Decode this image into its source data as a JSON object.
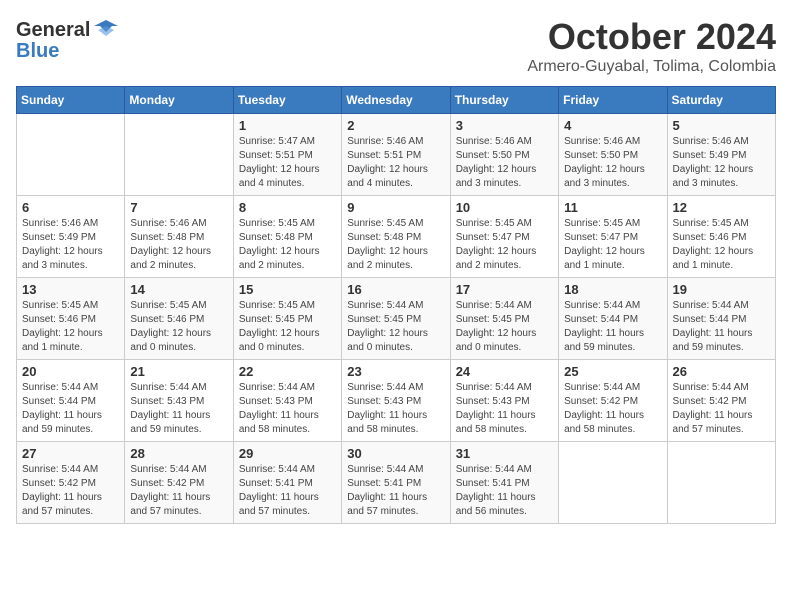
{
  "logo": {
    "line1": "General",
    "line2": "Blue"
  },
  "title": "October 2024",
  "subtitle": "Armero-Guyabal, Tolima, Colombia",
  "headers": [
    "Sunday",
    "Monday",
    "Tuesday",
    "Wednesday",
    "Thursday",
    "Friday",
    "Saturday"
  ],
  "weeks": [
    [
      {
        "day": "",
        "info": ""
      },
      {
        "day": "",
        "info": ""
      },
      {
        "day": "1",
        "info": "Sunrise: 5:47 AM\nSunset: 5:51 PM\nDaylight: 12 hours\nand 4 minutes."
      },
      {
        "day": "2",
        "info": "Sunrise: 5:46 AM\nSunset: 5:51 PM\nDaylight: 12 hours\nand 4 minutes."
      },
      {
        "day": "3",
        "info": "Sunrise: 5:46 AM\nSunset: 5:50 PM\nDaylight: 12 hours\nand 3 minutes."
      },
      {
        "day": "4",
        "info": "Sunrise: 5:46 AM\nSunset: 5:50 PM\nDaylight: 12 hours\nand 3 minutes."
      },
      {
        "day": "5",
        "info": "Sunrise: 5:46 AM\nSunset: 5:49 PM\nDaylight: 12 hours\nand 3 minutes."
      }
    ],
    [
      {
        "day": "6",
        "info": "Sunrise: 5:46 AM\nSunset: 5:49 PM\nDaylight: 12 hours\nand 3 minutes."
      },
      {
        "day": "7",
        "info": "Sunrise: 5:46 AM\nSunset: 5:48 PM\nDaylight: 12 hours\nand 2 minutes."
      },
      {
        "day": "8",
        "info": "Sunrise: 5:45 AM\nSunset: 5:48 PM\nDaylight: 12 hours\nand 2 minutes."
      },
      {
        "day": "9",
        "info": "Sunrise: 5:45 AM\nSunset: 5:48 PM\nDaylight: 12 hours\nand 2 minutes."
      },
      {
        "day": "10",
        "info": "Sunrise: 5:45 AM\nSunset: 5:47 PM\nDaylight: 12 hours\nand 2 minutes."
      },
      {
        "day": "11",
        "info": "Sunrise: 5:45 AM\nSunset: 5:47 PM\nDaylight: 12 hours\nand 1 minute."
      },
      {
        "day": "12",
        "info": "Sunrise: 5:45 AM\nSunset: 5:46 PM\nDaylight: 12 hours\nand 1 minute."
      }
    ],
    [
      {
        "day": "13",
        "info": "Sunrise: 5:45 AM\nSunset: 5:46 PM\nDaylight: 12 hours\nand 1 minute."
      },
      {
        "day": "14",
        "info": "Sunrise: 5:45 AM\nSunset: 5:46 PM\nDaylight: 12 hours\nand 0 minutes."
      },
      {
        "day": "15",
        "info": "Sunrise: 5:45 AM\nSunset: 5:45 PM\nDaylight: 12 hours\nand 0 minutes."
      },
      {
        "day": "16",
        "info": "Sunrise: 5:44 AM\nSunset: 5:45 PM\nDaylight: 12 hours\nand 0 minutes."
      },
      {
        "day": "17",
        "info": "Sunrise: 5:44 AM\nSunset: 5:45 PM\nDaylight: 12 hours\nand 0 minutes."
      },
      {
        "day": "18",
        "info": "Sunrise: 5:44 AM\nSunset: 5:44 PM\nDaylight: 11 hours\nand 59 minutes."
      },
      {
        "day": "19",
        "info": "Sunrise: 5:44 AM\nSunset: 5:44 PM\nDaylight: 11 hours\nand 59 minutes."
      }
    ],
    [
      {
        "day": "20",
        "info": "Sunrise: 5:44 AM\nSunset: 5:44 PM\nDaylight: 11 hours\nand 59 minutes."
      },
      {
        "day": "21",
        "info": "Sunrise: 5:44 AM\nSunset: 5:43 PM\nDaylight: 11 hours\nand 59 minutes."
      },
      {
        "day": "22",
        "info": "Sunrise: 5:44 AM\nSunset: 5:43 PM\nDaylight: 11 hours\nand 58 minutes."
      },
      {
        "day": "23",
        "info": "Sunrise: 5:44 AM\nSunset: 5:43 PM\nDaylight: 11 hours\nand 58 minutes."
      },
      {
        "day": "24",
        "info": "Sunrise: 5:44 AM\nSunset: 5:43 PM\nDaylight: 11 hours\nand 58 minutes."
      },
      {
        "day": "25",
        "info": "Sunrise: 5:44 AM\nSunset: 5:42 PM\nDaylight: 11 hours\nand 58 minutes."
      },
      {
        "day": "26",
        "info": "Sunrise: 5:44 AM\nSunset: 5:42 PM\nDaylight: 11 hours\nand 57 minutes."
      }
    ],
    [
      {
        "day": "27",
        "info": "Sunrise: 5:44 AM\nSunset: 5:42 PM\nDaylight: 11 hours\nand 57 minutes."
      },
      {
        "day": "28",
        "info": "Sunrise: 5:44 AM\nSunset: 5:42 PM\nDaylight: 11 hours\nand 57 minutes."
      },
      {
        "day": "29",
        "info": "Sunrise: 5:44 AM\nSunset: 5:41 PM\nDaylight: 11 hours\nand 57 minutes."
      },
      {
        "day": "30",
        "info": "Sunrise: 5:44 AM\nSunset: 5:41 PM\nDaylight: 11 hours\nand 57 minutes."
      },
      {
        "day": "31",
        "info": "Sunrise: 5:44 AM\nSunset: 5:41 PM\nDaylight: 11 hours\nand 56 minutes."
      },
      {
        "day": "",
        "info": ""
      },
      {
        "day": "",
        "info": ""
      }
    ]
  ]
}
